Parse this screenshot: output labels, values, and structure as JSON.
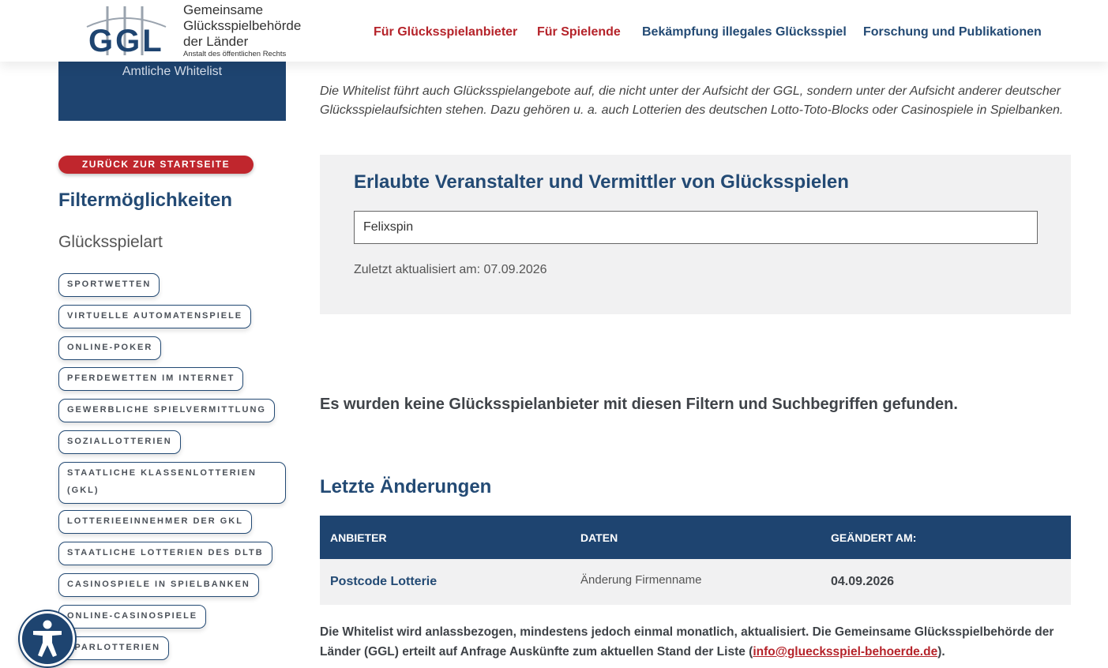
{
  "header": {
    "logo": {
      "letters": "GGL",
      "line1": "Gemeinsame",
      "line2": "Glücksspielbehörde",
      "line3": "der Länder",
      "sub": "Anstalt des öffentlichen Rechts"
    },
    "nav": [
      {
        "label": "Für Glücksspielanbieter"
      },
      {
        "label": "Für Spielende"
      },
      {
        "label": "Bekämpfung illegales Glücksspiel"
      },
      {
        "label": "Forschung und Publikationen"
      }
    ]
  },
  "sidebar": {
    "whitelist_label": "Amtliche Whitelist",
    "back_button": "ZURÜCK ZUR STARTSEITE",
    "filter_title": "Filtermöglichkeiten",
    "category_title": "Glücksspielart",
    "filters": [
      "SPORTWETTEN",
      "VIRTUELLE AUTOMATENSPIELE",
      "ONLINE-POKER",
      "PFERDEWETTEN IM INTERNET",
      "GEWERBLICHE SPIELVERMITTLUNG",
      "SOZIALLOTTERIEN",
      "STAATLICHE KLASSENLOTTERIEN (GKL)",
      "LOTTERIEEINNEHMER DER GKL",
      "STAATLICHE LOTTERIEN DES DLTB",
      "CASINOSPIELE IN SPIELBANKEN",
      "ONLINE-CASINOSPIELE",
      "SPARLOTTERIEN"
    ]
  },
  "main": {
    "intro": "Die Whitelist führt auch Glücksspielangebote auf, die nicht unter der Aufsicht der GGL, sondern unter der Aufsicht anderer deutscher Glücksspielaufsichten stehen. Dazu gehören u. a. auch Lotterien des deutschen Lotto-Toto-Blocks oder Casinospiele in Spielbanken.",
    "panel_title": "Erlaubte Veranstalter und Vermittler von Glücksspielen",
    "search_value": "Felixspin",
    "updated": "Zuletzt aktualisiert am: 07.09.2026",
    "no_results": "Es wurden keine Glücksspielanbieter mit diesen Filtern und Suchbegriffen gefunden.",
    "changes_title": "Letzte Änderungen",
    "table": {
      "headers": [
        "ANBIETER",
        "DATEN",
        "GEÄNDERT AM:"
      ],
      "rows": [
        [
          "Postcode Lotterie",
          "Änderung Firmenname",
          "04.09.2026"
        ]
      ]
    },
    "footnote_text": "Die Whitelist wird anlassbezogen, mindestens jedoch einmal monatlich, aktualisiert. Die Gemeinsame Glücksspielbehörde der Länder (GGL) erteilt auf Anfrage Auskünfte zum aktuellen Stand der Liste (",
    "footnote_email": "info@gluecksspiel-behoerde.de",
    "footnote_end": ")."
  },
  "colors": {
    "brand_blue": "#1e4470",
    "brand_red": "#c0262d"
  },
  "icons": {
    "accessibility": "accessibility-icon"
  }
}
